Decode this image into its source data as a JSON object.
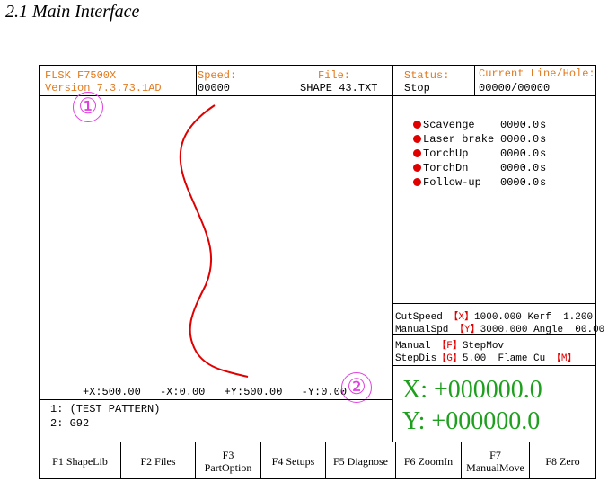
{
  "doc_heading": "2.1 Main Interface",
  "header": {
    "model": "FLSK F7500X",
    "version": "Version 7.3.73.1AD",
    "speed_label": "Speed:",
    "speed_value": "00000",
    "file_label": "File:",
    "file_value": "SHAPE 43.TXT",
    "status_label": "Status:",
    "status_value": "Stop",
    "line_label": "Current Line/Hole:",
    "line_value": "00000/00000"
  },
  "io_list": [
    {
      "name": "Scavenge",
      "value": "0000.0",
      "unit": "s"
    },
    {
      "name": "Laser brake",
      "value": "0000.0",
      "unit": "s"
    },
    {
      "name": "TorchUp",
      "value": "0000.0",
      "unit": "s"
    },
    {
      "name": "TorchDn",
      "value": "0000.0",
      "unit": "s"
    },
    {
      "name": "Follow-up",
      "value": "0000.0",
      "unit": "s"
    }
  ],
  "params": {
    "cutspeed_label": "CutSpeed",
    "cutspeed_key": "【X】",
    "cutspeed_value": "1000.000",
    "kerf_label": "Kerf",
    "kerf_value": "1.200",
    "manualspd_label": "ManualSpd",
    "manualspd_key": "【Y】",
    "manualspd_value": "3000.000",
    "angle_label": "Angle",
    "angle_value": "00.00"
  },
  "mode": {
    "manual_label": "Manual",
    "manual_key": "【F】",
    "manual_value": "StepMov",
    "stepdis_label": "StepDis",
    "stepdis_key": "【G】",
    "stepdis_value": "5.00",
    "flame_label": "Flame Cu",
    "flame_key": "【M】"
  },
  "limits": {
    "plus_x": "+X:500.00",
    "minus_x": "-X:0.00",
    "plus_y": "+Y:500.00",
    "minus_y": "-Y:0.00"
  },
  "program": {
    "line1": "1: (TEST PATTERN)",
    "line2": "2: G92"
  },
  "position": {
    "x": "X:  +000000.0",
    "y": "Y:  +000000.0"
  },
  "fkeys": [
    {
      "line1": "F1 ShapeLib",
      "line2": ""
    },
    {
      "line1": "F2 Files",
      "line2": ""
    },
    {
      "line1": "F3",
      "line2": "PartOption"
    },
    {
      "line1": "F4 Setups",
      "line2": ""
    },
    {
      "line1": "F5 Diagnose",
      "line2": ""
    },
    {
      "line1": "F6 ZoomIn",
      "line2": ""
    },
    {
      "line1": "F7",
      "line2": "ManualMove"
    },
    {
      "line1": "F8 Zero",
      "line2": ""
    }
  ],
  "callouts": {
    "c1": "①",
    "c2": "②"
  },
  "colors": {
    "accent_orange": "#e07a1f",
    "position_green": "#1ea01e",
    "indicator_red": "#e00000",
    "callout_magenta": "#e040e0"
  }
}
